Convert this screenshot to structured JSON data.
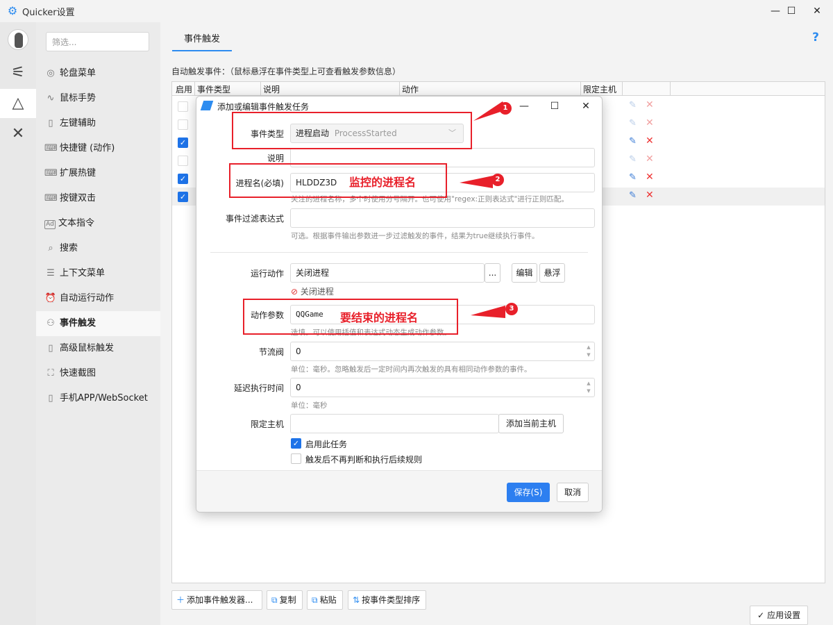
{
  "window": {
    "title": "Quicker设置",
    "app_icon": "gear-icon",
    "controls": {
      "minimize": "—",
      "maximize": "☐",
      "close": "✕"
    }
  },
  "rail": {
    "icons": [
      "sliders-icon",
      "shapes-icon",
      "tools-icon"
    ]
  },
  "sidebar": {
    "filter_placeholder": "筛选...",
    "items": [
      {
        "label": "轮盘菜单",
        "icon": "wheel-icon",
        "glyph": "◎"
      },
      {
        "label": "鼠标手势",
        "icon": "gesture-icon",
        "glyph": "∿"
      },
      {
        "label": "左键辅助",
        "icon": "mouse-icon",
        "glyph": "▯"
      },
      {
        "label": "快捷键 (动作)",
        "icon": "keyboard-icon",
        "glyph": "⌨"
      },
      {
        "label": "扩展热键",
        "icon": "keyboard-icon",
        "glyph": "⌨"
      },
      {
        "label": "按键双击",
        "icon": "keyboard-icon",
        "glyph": "⌨"
      },
      {
        "label": "文本指令",
        "icon": "text-ad-icon",
        "glyph": "Ad"
      },
      {
        "label": "搜索",
        "icon": "search-icon",
        "glyph": "⌕"
      },
      {
        "label": "上下文菜单",
        "icon": "list-icon",
        "glyph": "☰"
      },
      {
        "label": "自动运行动作",
        "icon": "alarm-icon",
        "glyph": "⏰"
      },
      {
        "label": "事件触发",
        "icon": "event-icon",
        "glyph": "⚇"
      },
      {
        "label": "高级鼠标触发",
        "icon": "mouse-icon",
        "glyph": "▯"
      },
      {
        "label": "快速截图",
        "icon": "screenshot-icon",
        "glyph": "⛶"
      },
      {
        "label": "手机APP/WebSocket",
        "icon": "phone-icon",
        "glyph": "▯"
      }
    ]
  },
  "main": {
    "tab": "事件触发",
    "help": "?",
    "hint": "自动触发事件：（鼠标悬浮在事件类型上可查看触发参数信息）",
    "columns": [
      "启用",
      "事件类型",
      "说明",
      "动作",
      "限定主机"
    ],
    "rows": [
      {
        "enabled": false,
        "dim": true
      },
      {
        "enabled": false,
        "dim": true
      },
      {
        "enabled": true,
        "dim": false
      },
      {
        "enabled": false,
        "dim": true
      },
      {
        "enabled": true,
        "dim": false
      },
      {
        "enabled": true,
        "dim": false
      }
    ],
    "bottom_buttons": [
      "添加事件触发器...",
      "复制",
      "粘贴",
      "按事件类型排序"
    ],
    "apply": "应用设置",
    "check_glyph": "✓"
  },
  "dialog": {
    "title": "添加或编辑事件触发任务",
    "event_type_label": "事件类型",
    "event_type_value": "进程启动",
    "event_type_value_en": "ProcessStarted",
    "desc_label": "说明",
    "process_label": "进程名(必填)",
    "process_value": "HLDDZ3D",
    "process_hint": "关注的进程名称，多个时使用分号隔开。也可使用\"regex:正则表达式\"进行正则匹配。",
    "filter_label": "事件过滤表达式",
    "filter_hint": "可选。根据事件输出参数进一步过滤触发的事件，结果为true继续执行事件。",
    "action_label": "运行动作",
    "action_value": "关闭进程",
    "more_btn": "...",
    "edit_btn": "编辑",
    "float_btn": "悬浮",
    "action_tag": "关闭进程",
    "param_label": "动作参数",
    "param_value": "QQGame",
    "param_hint": "选填。可以使用插值和表达式动态生成动作参数。",
    "throttle_label": "节流阀",
    "throttle_value": "0",
    "throttle_hint": "单位：毫秒。忽略触发后一定时间内再次触发的具有相同动作参数的事件。",
    "delay_label": "延迟执行时间",
    "delay_value": "0",
    "delay_hint": "单位：毫秒",
    "host_label": "限定主机",
    "host_value": "",
    "add_host_btn": "添加当前主机",
    "enable_task": "启用此任务",
    "enable_task_checked": true,
    "stop_rules": "触发后不再判断和执行后续规则",
    "stop_rules_checked": false,
    "save": "保存(S)",
    "cancel": "取消"
  },
  "annotations": {
    "color": "#e8202a",
    "markers": [
      "1",
      "2",
      "3"
    ],
    "process_note": "监控的进程名",
    "param_note": "要结束的进程名"
  }
}
